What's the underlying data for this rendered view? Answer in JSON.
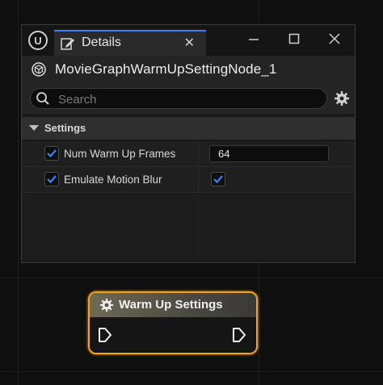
{
  "details_window": {
    "tab_title": "Details",
    "tab_close": "✕",
    "window_controls": {
      "minimize": "—",
      "maximize": "☐",
      "close": "✕"
    },
    "object_name": "MovieGraphWarmUpSettingNode_1",
    "search": {
      "placeholder": "Search",
      "value": ""
    },
    "section": {
      "label": "Settings"
    },
    "properties": [
      {
        "label": "Num Warm Up Frames",
        "enabled": true,
        "value": "64"
      },
      {
        "label": "Emulate Motion Blur",
        "enabled": true,
        "value_checked": true
      }
    ]
  },
  "node": {
    "title": "Warm Up Settings"
  },
  "colors": {
    "accent": "#3f7fff",
    "node_highlight": "#f0a21a",
    "checkbox": "#3f7fff"
  },
  "icons": {
    "app_logo": "unreal-logo-icon",
    "tab_icon": "pencil-edit-icon",
    "object_icon": "cube-class-icon",
    "search": "search-icon",
    "settings": "gear-icon",
    "node_icon": "gear-icon",
    "exec_pin": "exec-pin-icon"
  }
}
